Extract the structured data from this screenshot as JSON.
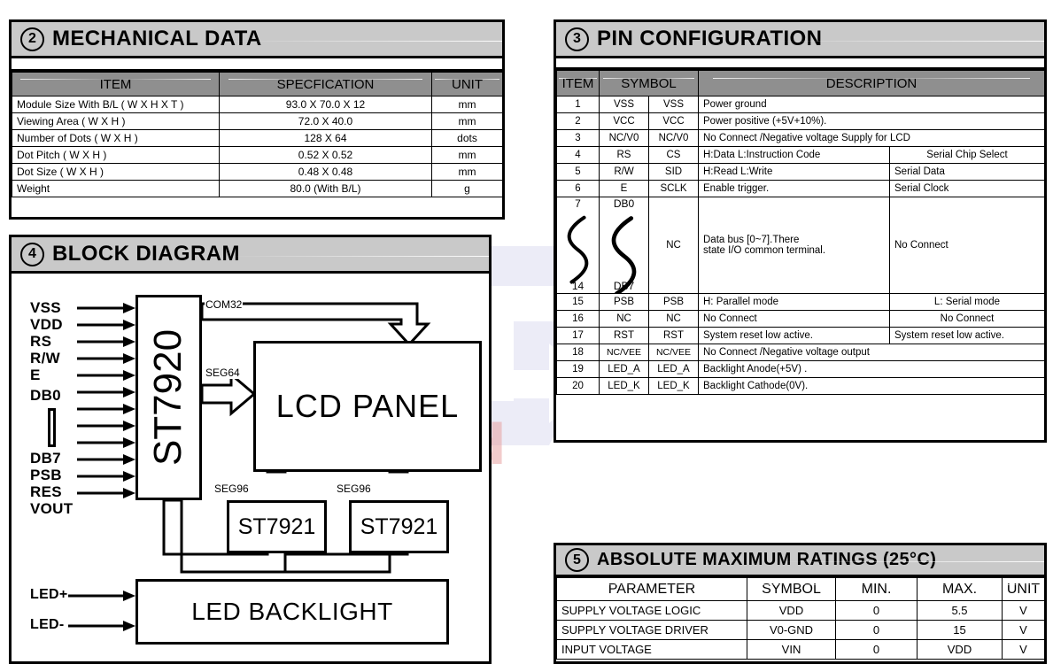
{
  "mechanical": {
    "number": "2",
    "title": "MECHANICAL DATA",
    "headers": [
      "ITEM",
      "SPECFICATION",
      "UNIT"
    ],
    "rows": [
      [
        "Module Size With B/L ( W X H X T )",
        "93.0 X 70.0 X 12",
        "mm"
      ],
      [
        "Viewing Area ( W X H )",
        "72.0 X 40.0",
        "mm"
      ],
      [
        "Number of Dots ( W X H )",
        "128 X 64",
        "dots"
      ],
      [
        "Dot Pitch ( W X H )",
        "0.52 X 0.52",
        "mm"
      ],
      [
        "Dot Size ( W X H )",
        "0.48 X 0.48",
        "mm"
      ],
      [
        "Weight",
        "80.0 (With B/L)",
        "g"
      ]
    ]
  },
  "pinconfig": {
    "number": "3",
    "title": "PIN CONFIGURATION",
    "headers": [
      "ITEM",
      "SYMBOL",
      "DESCRIPTION"
    ],
    "rows": [
      {
        "item": "1",
        "sym1": "VSS",
        "sym2": "VSS",
        "desc1": "Power ground",
        "desc2": "",
        "span": true
      },
      {
        "item": "2",
        "sym1": "VCC",
        "sym2": "VCC",
        "desc1": "Power positive   (+5V+10%).",
        "desc2": "",
        "span": true
      },
      {
        "item": "3",
        "sym1": "NC/V0",
        "sym2": "NC/V0",
        "desc1": "No Connect /Negative voltage Supply for LCD",
        "desc2": "",
        "span": true
      },
      {
        "item": "4",
        "sym1": "RS",
        "sym2": "CS",
        "desc1": "H:Data   L:Instruction Code",
        "desc2": "Serial Chip Select",
        "span": false
      },
      {
        "item": "5",
        "sym1": "R/W",
        "sym2": "SID",
        "desc1": "H:Read  L:Write",
        "desc2": "Serial Data",
        "span": false
      },
      {
        "item": "6",
        "sym1": "E",
        "sym2": "SCLK",
        "desc1": "Enable trigger.",
        "desc2": "Serial Clock",
        "span": false
      },
      {
        "item": "15",
        "sym1": "PSB",
        "sym2": "PSB",
        "desc1": "H: Parallel mode",
        "desc2": "L: Serial mode",
        "span": false
      },
      {
        "item": "16",
        "sym1": "NC",
        "sym2": "NC",
        "desc1": "No Connect",
        "desc2": "No Connect",
        "span": false
      },
      {
        "item": "17",
        "sym1": "RST",
        "sym2": "RST",
        "desc1": "System reset low active.",
        "desc2": "System reset low active.",
        "span": false
      },
      {
        "item": "18",
        "sym1": "NC/VEE",
        "sym2": "NC/VEE",
        "desc1": "No Connect /Negative voltage output",
        "desc2": "",
        "span": true
      },
      {
        "item": "19",
        "sym1": "LED_A",
        "sym2": "LED_A",
        "desc1": "Backlight Anode(+5V) .",
        "desc2": "",
        "span": true
      },
      {
        "item": "20",
        "sym1": "LED_K",
        "sym2": "LED_K",
        "desc1": "Backlight Cathode(0V).",
        "desc2": "",
        "span": true
      }
    ],
    "databus": {
      "item_top": "7",
      "item_bottom": "14",
      "sym_top": "DB0",
      "sym_bottom": "DB7",
      "sym2": "NC",
      "desc1_line1": "Data bus [0~7].There",
      "desc1_line2": "state I/O common terminal.",
      "desc2": "No Connect"
    }
  },
  "blockdiagram": {
    "number": "4",
    "title": "BLOCK DIAGRAM",
    "controller": "ST7920",
    "panel": "LCD PANEL",
    "driver_left": "ST7921",
    "driver_right": "ST7921",
    "backlight": "LED BACKLIGHT",
    "bus_labels": {
      "com": "COM32",
      "seg64": "SEG64",
      "seg96_left": "SEG96",
      "seg96_right": "SEG96"
    },
    "pins": [
      "VSS",
      "VDD",
      "RS",
      "R/W",
      "E",
      "DB0",
      "DB7",
      "PSB",
      "RES",
      "VOUT"
    ],
    "backlight_pins": [
      "LED+",
      "LED-"
    ]
  },
  "absmax": {
    "number": "5",
    "title": "ABSOLUTE MAXIMUM RATINGS (25°C)",
    "headers": [
      "PARAMETER",
      "SYMBOL",
      "MIN.",
      "MAX.",
      "UNIT"
    ],
    "rows": [
      [
        "SUPPLY VOLTAGE LOGIC",
        "VDD",
        "0",
        "5.5",
        "V"
      ],
      [
        "SUPPLY VOLTAGE DRIVER",
        "V0-GND",
        "0",
        "15",
        "V"
      ],
      [
        "INPUT VOLTAGE",
        "VIN",
        "0",
        "VDD",
        "V"
      ]
    ]
  },
  "watermark": {
    "text_part1": "ce",
    "text_part2": "iid",
    "color": "#b9b9e4"
  }
}
